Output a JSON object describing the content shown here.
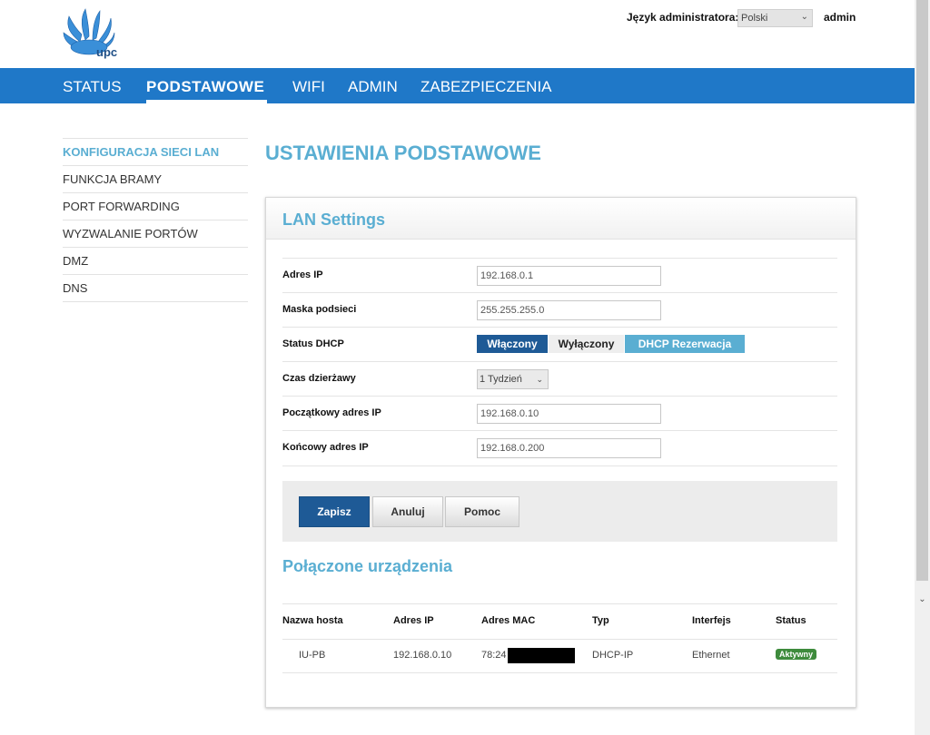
{
  "brand": {
    "logo_text": "upc"
  },
  "header": {
    "lang_label": "Język administratora:",
    "lang_value": "Polski",
    "user": "admin"
  },
  "nav": [
    "STATUS",
    "PODSTAWOWE",
    "WIFI",
    "ADMIN",
    "ZABEZPIECZENIA"
  ],
  "sidebar": [
    "KONFIGURACJA SIECI LAN",
    "FUNKCJA BRAMY",
    "PORT FORWARDING",
    "WYZWALANIE PORTÓW",
    "DMZ",
    "DNS"
  ],
  "page_title": "USTAWIENIA PODSTAWOWE",
  "lan": {
    "title": "LAN Settings",
    "ip_label": "Adres IP",
    "ip_value": "192.168.0.1",
    "mask_label": "Maska podsieci",
    "mask_value": "255.255.255.0",
    "dhcp_label": "Status DHCP",
    "dhcp_on": "Włączony",
    "dhcp_off": "Wyłączony",
    "dhcp_reserve": "DHCP Rezerwacja",
    "lease_label": "Czas dzierżawy",
    "lease_value": "1 Tydzień",
    "start_label": "Początkowy adres IP",
    "start_value": "192.168.0.10",
    "end_label": "Końcowy adres IP",
    "end_value": "192.168.0.200"
  },
  "buttons": {
    "save": "Zapisz",
    "cancel": "Anuluj",
    "help": "Pomoc"
  },
  "devices": {
    "title": "Połączone urządzenia",
    "columns": [
      "Nazwa hosta",
      "Adres IP",
      "Adres MAC",
      "Typ",
      "Interfejs",
      "Status"
    ],
    "rows": [
      {
        "host": "IU-PB",
        "ip": "192.168.0.10",
        "mac": "78:24",
        "type": "DHCP-IP",
        "iface": "Ethernet",
        "status": "Aktywny"
      }
    ]
  }
}
